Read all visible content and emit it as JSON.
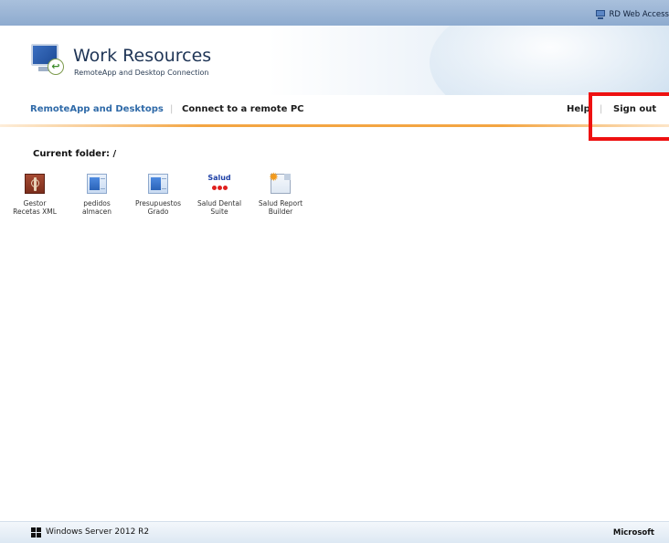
{
  "topbar": {
    "rd_web_access": "RD Web Access"
  },
  "header": {
    "title": "Work Resources",
    "subtitle": "RemoteApp and Desktop Connection"
  },
  "nav": {
    "tab_remoteapp": "RemoteApp and Desktops",
    "separator": "|",
    "tab_connect": "Connect to a remote PC",
    "help": "Help",
    "sign_out": "Sign out"
  },
  "folder": {
    "label": "Current folder: /"
  },
  "apps": [
    {
      "line1": "Gestor",
      "line2": "Recetas XML",
      "icon": "caduceus-icon"
    },
    {
      "line1": "pedidos",
      "line2": "almacen",
      "icon": "window-app-icon"
    },
    {
      "line1": "Presupuestos",
      "line2": "Grado",
      "icon": "window-app-icon"
    },
    {
      "line1": "Salud Dental",
      "line2": "Suite",
      "icon": "salud-logo-icon",
      "icon_text": "Salud"
    },
    {
      "line1": "Salud Report",
      "line2": "Builder",
      "icon": "report-builder-icon"
    }
  ],
  "footer": {
    "windows_server": "Windows Server 2012 R2",
    "microsoft": "Microsoft"
  },
  "colors": {
    "accent_orange": "#f3a542",
    "nav_blue": "#2f6aa8",
    "highlight_red": "#ee1111"
  }
}
